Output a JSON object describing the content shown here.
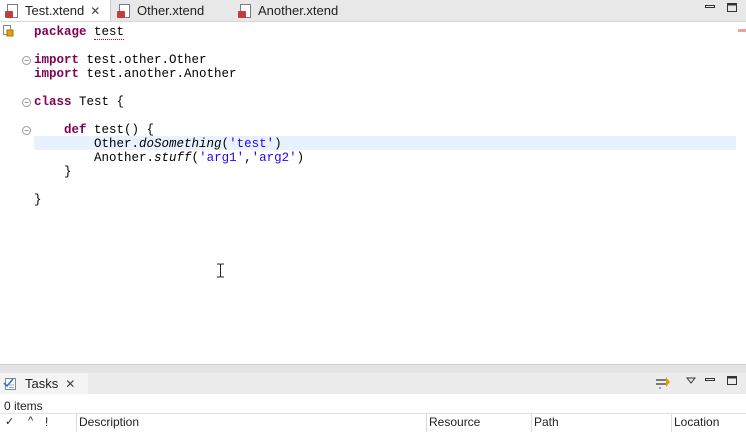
{
  "editor_tabs": [
    {
      "label": "Test.xtend",
      "active": true,
      "closable": true
    },
    {
      "label": "Other.xtend",
      "active": false
    },
    {
      "label": "Another.xtend",
      "active": false
    }
  ],
  "code": {
    "package_kw": "package",
    "package_name": "test",
    "import_kw": "import",
    "import1": "test.other.Other",
    "import2": "test.another.Another",
    "class_kw": "class",
    "class_rest": "Test {",
    "def_kw": "def",
    "def_rest": "test() {",
    "call1_recv": "Other.",
    "call1_method": "doSomething",
    "call1_open": "(",
    "call1_arg": "'test'",
    "call1_close": ")",
    "call2_recv": "Another.",
    "call2_method": "stuff",
    "call2_open": "(",
    "call2_arg1": "'arg1'",
    "call2_comma": ",",
    "call2_arg2": "'arg2'",
    "call2_close": ")",
    "close_brace": "}"
  },
  "tasks_view": {
    "title": "Tasks",
    "items_count": "0 items",
    "columns": {
      "check": "✓",
      "priority_sort": "^",
      "priority": "!",
      "description": "Description",
      "resource": "Resource",
      "path": "Path",
      "location": "Location"
    }
  },
  "colors": {
    "keyword": "#7f0055",
    "string": "#2a00ff",
    "current_line": "#e8f2fe"
  }
}
